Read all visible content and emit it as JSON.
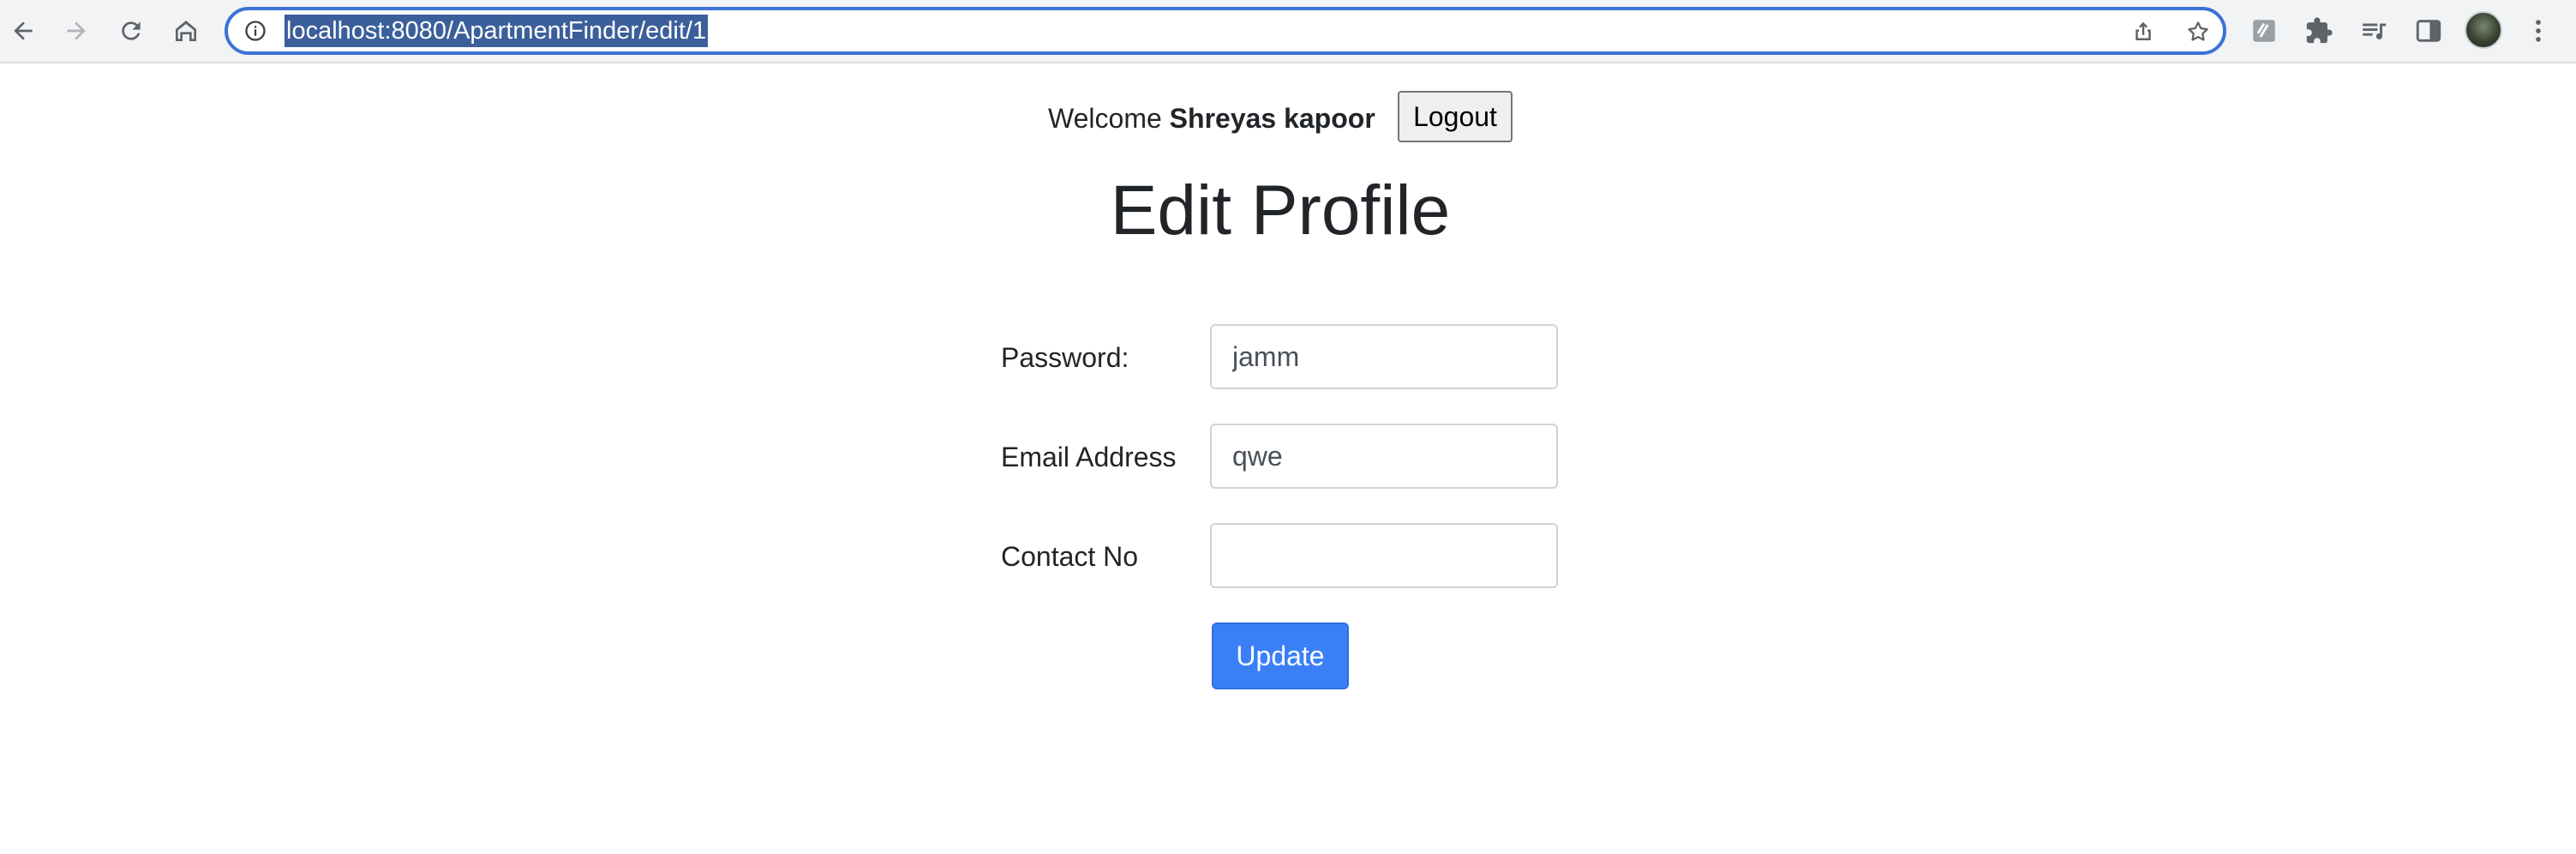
{
  "browser": {
    "url": "localhost:8080/ApartmentFinder/edit/1",
    "accent_color": "#3b73d6",
    "icons": [
      "back-icon",
      "forward-icon",
      "reload-icon",
      "home-icon",
      "site-info-icon",
      "share-icon",
      "bookmark-star-icon",
      "extension-icon",
      "puzzle-icon",
      "media-control-icon",
      "side-panel-icon",
      "profile-avatar",
      "more-menu-icon"
    ]
  },
  "header": {
    "welcome_prefix": "Welcome",
    "user_name": "Shreyas kapoor",
    "logout_label": "Logout"
  },
  "page": {
    "title": "Edit Profile"
  },
  "form": {
    "password": {
      "label": "Password:",
      "value": "jamm"
    },
    "email": {
      "label": "Email Address",
      "value": "qwe"
    },
    "contact": {
      "label": "Contact No",
      "value": ""
    },
    "submit_label": "Update",
    "submit_color": "#3a7ff6"
  }
}
